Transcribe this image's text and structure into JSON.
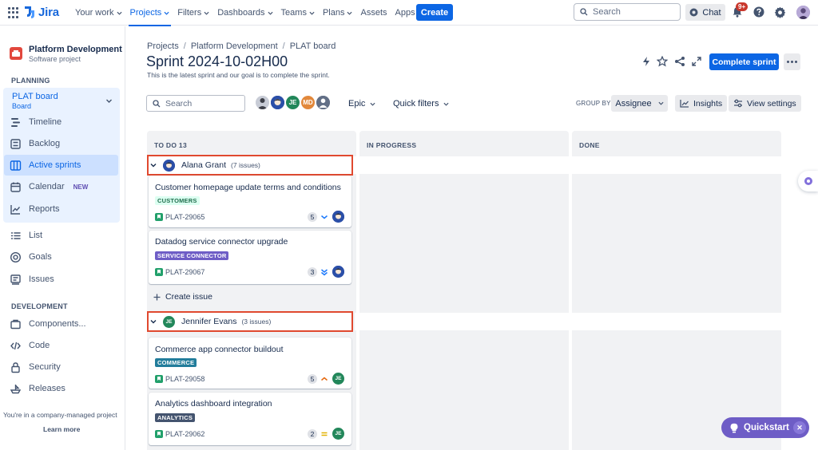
{
  "topnav": {
    "product": "Jira",
    "items": [
      {
        "label": "Your work",
        "active": false
      },
      {
        "label": "Projects",
        "active": true
      },
      {
        "label": "Filters",
        "active": false
      },
      {
        "label": "Dashboards",
        "active": false
      },
      {
        "label": "Teams",
        "active": false
      },
      {
        "label": "Plans",
        "active": false
      },
      {
        "label": "Assets",
        "active": false
      },
      {
        "label": "Apps",
        "active": false
      }
    ],
    "create_label": "Create",
    "search_placeholder": "Search",
    "chat_label": "Chat",
    "notifications_badge": "9+",
    "brand_color": "#0c66e4"
  },
  "sidebar": {
    "project_name": "Platform Development",
    "project_type": "Software project",
    "planning_label": "PLANNING",
    "board_name": "PLAT board",
    "board_sub": "Board",
    "planning_items": [
      {
        "label": "Timeline",
        "icon": "timeline-icon"
      },
      {
        "label": "Backlog",
        "icon": "backlog-icon"
      },
      {
        "label": "Active sprints",
        "icon": "board-icon",
        "active": true
      },
      {
        "label": "Calendar",
        "icon": "calendar-icon",
        "badge": "NEW"
      },
      {
        "label": "Reports",
        "icon": "reports-icon"
      }
    ],
    "other_items": [
      {
        "label": "List",
        "icon": "list-icon"
      },
      {
        "label": "Goals",
        "icon": "goals-icon"
      },
      {
        "label": "Issues",
        "icon": "issues-icon"
      }
    ],
    "development_label": "DEVELOPMENT",
    "dev_items": [
      {
        "label": "Components...",
        "icon": "components-icon"
      },
      {
        "label": "Code",
        "icon": "code-icon"
      },
      {
        "label": "Security",
        "icon": "lock-icon"
      },
      {
        "label": "Releases",
        "icon": "ship-icon"
      }
    ],
    "company_note": "You're in a company-managed project",
    "learn_more": "Learn more"
  },
  "header": {
    "breadcrumbs": [
      "Projects",
      "Platform Development",
      "PLAT board"
    ],
    "title": "Sprint 2024-10-02H00",
    "goal": "This is the latest sprint and our goal is to complete the sprint.",
    "complete_sprint_label": "Complete sprint"
  },
  "filters": {
    "search_placeholder": "Search",
    "avatar_initials": [
      "JE",
      "MD"
    ],
    "epic_label": "Epic",
    "quick_filters_label": "Quick filters",
    "group_by_label": "GROUP BY",
    "group_by_value": "Assignee",
    "insights_label": "Insights",
    "view_settings_label": "View settings"
  },
  "columns": [
    {
      "title": "TO DO 13"
    },
    {
      "title": "IN PROGRESS"
    },
    {
      "title": "DONE"
    }
  ],
  "swimlanes": [
    {
      "name": "Alana Grant",
      "count": "(7 issues)",
      "initials": "",
      "cards": [
        {
          "title": "Customer homepage update terms and conditions",
          "label": "CUSTOMERS",
          "key": "PLAT-29065",
          "points": "5",
          "priority": "low"
        },
        {
          "title": "Datadog service connector upgrade",
          "label": "SERVICE CONNECTOR",
          "key": "PLAT-29067",
          "points": "3",
          "priority": "lowest"
        }
      ],
      "create_issue_label": "Create issue"
    },
    {
      "name": "Jennifer Evans",
      "count": "(3 issues)",
      "initials": "JE",
      "cards": [
        {
          "title": "Commerce app connector buildout",
          "label": "COMMERCE",
          "key": "PLAT-29058",
          "points": "5",
          "priority": "high"
        },
        {
          "title": "Analytics dashboard integration",
          "label": "ANALYTICS",
          "key": "PLAT-29062",
          "points": "2",
          "priority": "medium"
        }
      ]
    }
  ],
  "quickstart_label": "Quickstart"
}
